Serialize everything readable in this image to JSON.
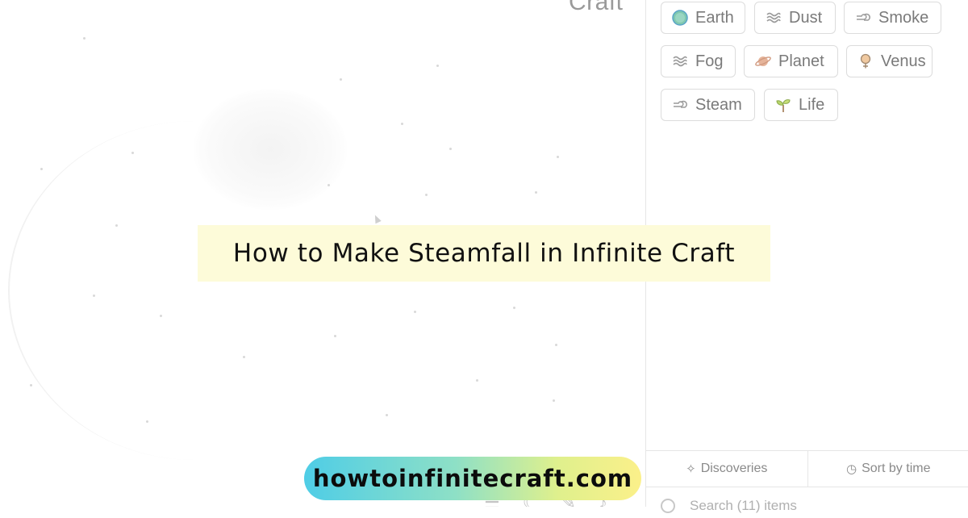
{
  "canvas": {
    "logo_text": "Craft"
  },
  "sidebar": {
    "items": [
      {
        "label": "Earth",
        "icon": "earth-globe-icon"
      },
      {
        "label": "Dust",
        "icon": "wind-waves-icon"
      },
      {
        "label": "Smoke",
        "icon": "cloud-puff-icon"
      },
      {
        "label": "Fog",
        "icon": "wind-waves-icon"
      },
      {
        "label": "Planet",
        "icon": "ringed-planet-icon"
      },
      {
        "label": "Venus",
        "icon": "venus-icon"
      },
      {
        "label": "Steam",
        "icon": "cloud-puff-icon"
      },
      {
        "label": "Life",
        "icon": "seedling-icon"
      }
    ],
    "discoveries_label": "Discoveries",
    "sort_label": "Sort by time",
    "search_placeholder": "Search (11) items"
  },
  "overlay": {
    "title": "How to Make Steamfall in Infinite Craft",
    "url": "howtoinfinitecraft.com"
  },
  "colors": {
    "title_banner_bg": "#fdfbd9",
    "pill_gradient_start": "#4fcde6",
    "pill_gradient_end": "#fbf08a"
  }
}
